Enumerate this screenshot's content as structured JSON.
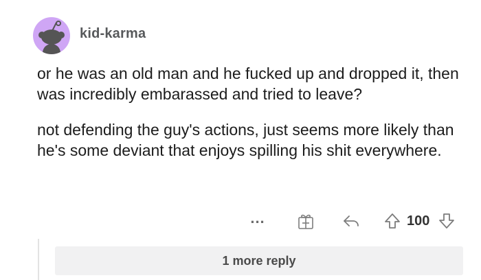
{
  "comment": {
    "username": "kid-karma",
    "avatar_icon": "reddit-snoo-avatar-icon",
    "avatar_bg": "#cfa6f5",
    "paragraphs": [
      "or he was an old man and he fucked up and dropped it, then was incredibly embarassed and tried to leave?",
      "not defending the guy's actions, just seems more likely than he's some deviant that enjoys spilling his shit everywhere."
    ],
    "actions": {
      "more_label": "...",
      "award_icon": "gift-award-icon",
      "reply_icon": "reply-arrow-icon",
      "upvote_icon": "upvote-arrow-icon",
      "score": "100",
      "downvote_icon": "downvote-arrow-icon"
    },
    "more_replies_label": "1 more reply"
  }
}
